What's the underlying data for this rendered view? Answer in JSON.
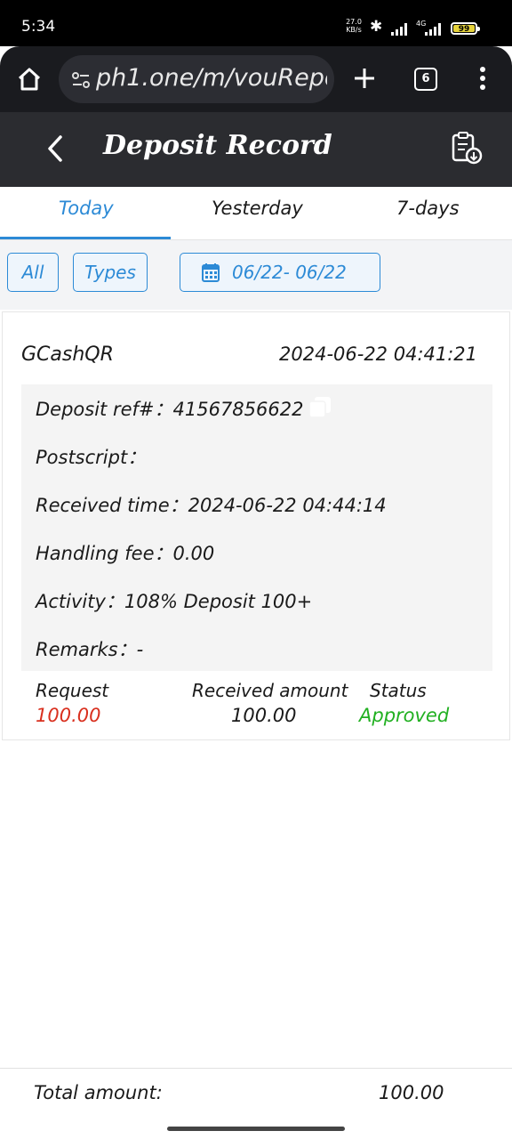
{
  "status_bar": {
    "time": "5:34",
    "net_speed_value": "27.0",
    "net_speed_unit": "KB/s",
    "battery": "99",
    "battery_color": "#e5d23a"
  },
  "browser": {
    "url": "ph1.one/m/vouRepo",
    "tab_count": "6"
  },
  "app": {
    "title": "Deposit Record",
    "accent_color": "#2c8ad6"
  },
  "tabs": [
    {
      "label": "Today",
      "active": true
    },
    {
      "label": "Yesterday",
      "active": false
    },
    {
      "label": "7-days",
      "active": false
    }
  ],
  "filters": {
    "all_label": "All",
    "types_label": "Types",
    "date_range": "06/22- 06/22"
  },
  "record": {
    "method": "GCashQR",
    "datetime": "2024-06-22 04:41:21",
    "deposit_ref": "Deposit ref#：41567856622",
    "postscript": "Postscript：",
    "received_time": "Received time：2024-06-22 04:44:14",
    "handling_fee": "Handling fee：0.00",
    "activity": "Activity：108% Deposit 100+",
    "remarks": "Remarks：-",
    "request_label": "Request",
    "request_value": "100.00",
    "request_color": "#d9301f",
    "received_label": "Received amount",
    "received_value": "100.00",
    "status_label": "Status",
    "status_value": "Approved",
    "status_color": "#21b021"
  },
  "footer": {
    "total_label": "Total amount:",
    "total_value": "100.00"
  }
}
